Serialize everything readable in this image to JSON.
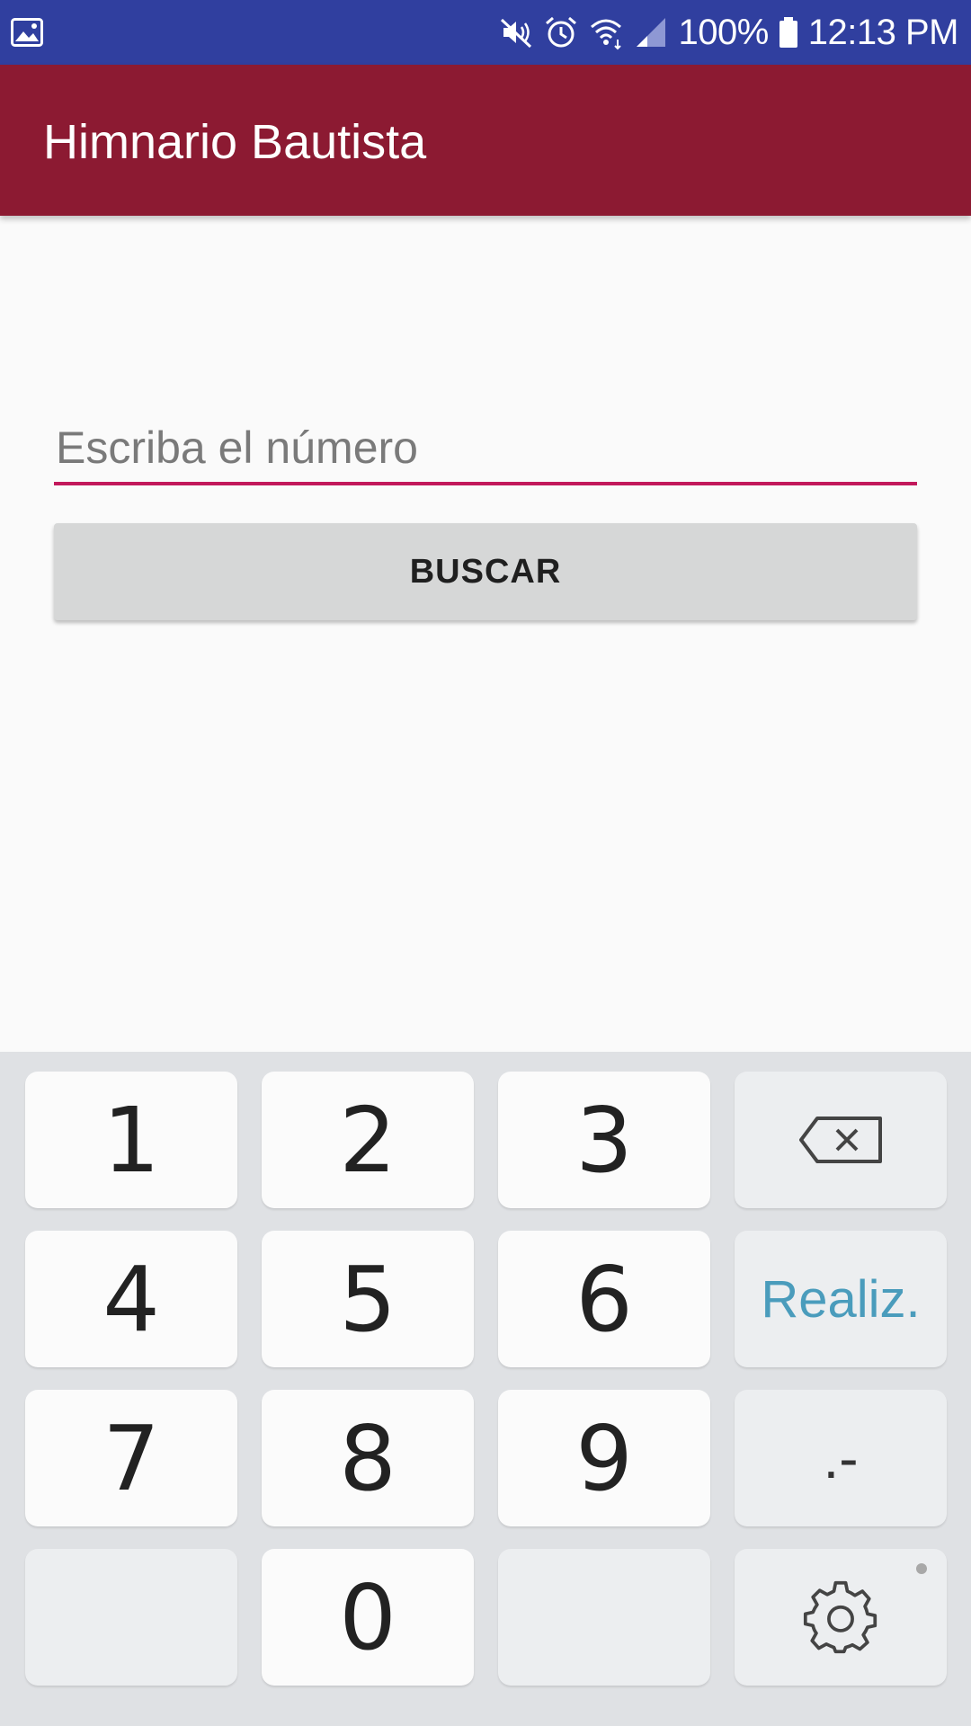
{
  "status_bar": {
    "battery_percent": "100%",
    "time": "12:13 PM",
    "icons": [
      "gallery-icon",
      "mute-icon",
      "alarm-icon",
      "wifi-icon",
      "signal-icon",
      "battery-icon"
    ]
  },
  "app_bar": {
    "title": "Himnario Bautista"
  },
  "search": {
    "placeholder": "Escriba el número",
    "value": "",
    "button_label": "BUSCAR"
  },
  "keyboard": {
    "keys": {
      "k1": "1",
      "k2": "2",
      "k3": "3",
      "k4": "4",
      "k5": "5",
      "k6": "6",
      "k7": "7",
      "k8": "8",
      "k9": "9",
      "k0": "0"
    },
    "done_label": "Realiz.",
    "symbol_label": ".-",
    "icons": [
      "backspace-icon",
      "settings-icon"
    ]
  },
  "colors": {
    "status_bar": "#303f9f",
    "app_bar": "#8c1a32",
    "accent_underline": "#c2185b",
    "done_text": "#4a9cbc"
  }
}
